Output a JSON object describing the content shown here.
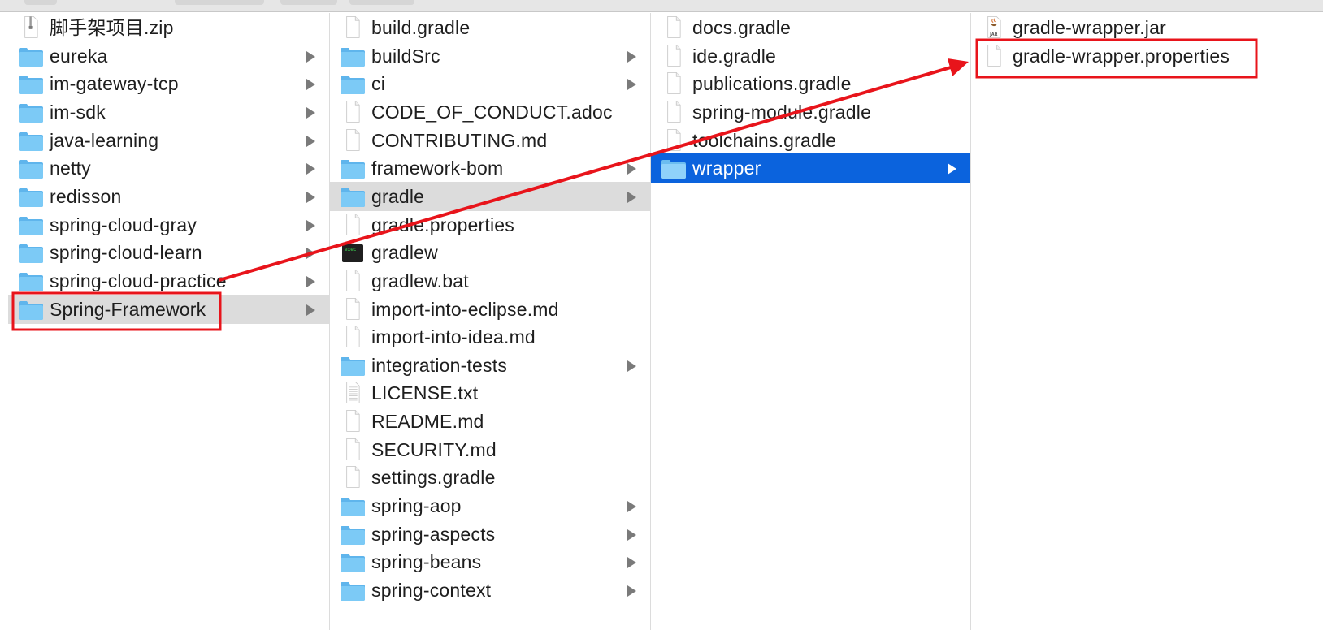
{
  "columns": [
    {
      "items": [
        {
          "name": "脚手架项目.zip",
          "type": "zip",
          "left_chevron": true
        },
        {
          "name": "eureka",
          "type": "folder",
          "arrow": true
        },
        {
          "name": "im-gateway-tcp",
          "type": "folder",
          "arrow": true,
          "left_chevron": true
        },
        {
          "name": "im-sdk",
          "type": "folder",
          "arrow": true
        },
        {
          "name": "java-learning",
          "type": "folder",
          "arrow": true
        },
        {
          "name": "netty",
          "type": "folder",
          "arrow": true
        },
        {
          "name": "redisson",
          "type": "folder",
          "arrow": true
        },
        {
          "name": "spring-cloud-gray",
          "type": "folder",
          "arrow": true
        },
        {
          "name": "spring-cloud-learn",
          "type": "folder",
          "arrow": true
        },
        {
          "name": "spring-cloud-practice",
          "type": "folder",
          "arrow": true
        },
        {
          "name": "Spring-Framework",
          "type": "folder",
          "arrow": true,
          "selected": "gray",
          "highlighted": true
        }
      ]
    },
    {
      "items": [
        {
          "name": "build.gradle",
          "type": "file"
        },
        {
          "name": "buildSrc",
          "type": "folder",
          "arrow": true
        },
        {
          "name": "ci",
          "type": "folder",
          "arrow": true
        },
        {
          "name": "CODE_OF_CONDUCT.adoc",
          "type": "file"
        },
        {
          "name": "CONTRIBUTING.md",
          "type": "file"
        },
        {
          "name": "framework-bom",
          "type": "folder",
          "arrow": true
        },
        {
          "name": "gradle",
          "type": "folder",
          "arrow": true,
          "selected": "gray"
        },
        {
          "name": "gradle.properties",
          "type": "file"
        },
        {
          "name": "gradlew",
          "type": "exec"
        },
        {
          "name": "gradlew.bat",
          "type": "file"
        },
        {
          "name": "import-into-eclipse.md",
          "type": "file"
        },
        {
          "name": "import-into-idea.md",
          "type": "file"
        },
        {
          "name": "integration-tests",
          "type": "folder",
          "arrow": true
        },
        {
          "name": "LICENSE.txt",
          "type": "text"
        },
        {
          "name": "README.md",
          "type": "file"
        },
        {
          "name": "SECURITY.md",
          "type": "file"
        },
        {
          "name": "settings.gradle",
          "type": "file"
        },
        {
          "name": "spring-aop",
          "type": "folder",
          "arrow": true
        },
        {
          "name": "spring-aspects",
          "type": "folder",
          "arrow": true
        },
        {
          "name": "spring-beans",
          "type": "folder",
          "arrow": true
        },
        {
          "name": "spring-context",
          "type": "folder",
          "arrow": true
        }
      ]
    },
    {
      "items": [
        {
          "name": "docs.gradle",
          "type": "file"
        },
        {
          "name": "ide.gradle",
          "type": "file"
        },
        {
          "name": "publications.gradle",
          "type": "file"
        },
        {
          "name": "spring-module.gradle",
          "type": "file"
        },
        {
          "name": "toolchains.gradle",
          "type": "file"
        },
        {
          "name": "wrapper",
          "type": "folder",
          "arrow": true,
          "selected": "blue"
        }
      ]
    },
    {
      "items": [
        {
          "name": "gradle-wrapper.jar",
          "type": "jar"
        },
        {
          "name": "gradle-wrapper.properties",
          "type": "file",
          "highlighted": true
        }
      ]
    }
  ],
  "icon_labels": {
    "jar": "JAR"
  },
  "colors": {
    "selection_blue": "#0b63dd",
    "selection_gray": "#dcdcdc",
    "annotation_red": "#e8141b",
    "folder_blue": "#7ccaf6",
    "chevron_gray": "#7a7a7a"
  }
}
